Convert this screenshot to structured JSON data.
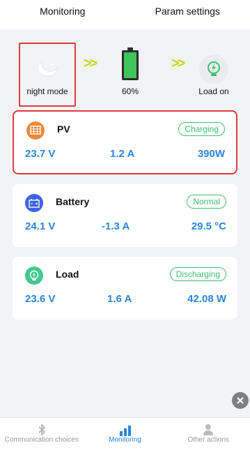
{
  "top_tabs": {
    "monitoring": "Monitoring",
    "param_settings": "Param settings"
  },
  "flow": {
    "mode_label": "night mode",
    "battery_label": "60%",
    "battery_level": 0.6,
    "load_label": "Load on"
  },
  "cards": {
    "pv": {
      "name": "PV",
      "status": "Charging",
      "voltage": "23.7 V",
      "current": "1.2 A",
      "power": "390W"
    },
    "battery": {
      "name": "Battery",
      "status": "Normal",
      "voltage": "24.1 V",
      "current": "-1.3 A",
      "temperature": "29.5 °C"
    },
    "load": {
      "name": "Load",
      "status": "Discharging",
      "voltage": "23.6 V",
      "current": "1.6 A",
      "power": "42.08 W"
    }
  },
  "bottom_nav": {
    "communication": "Communication choices",
    "monitoring": "Monitoring",
    "other": "Other actions"
  },
  "colors": {
    "accent": "#2a86d7",
    "status_green": "#3bbf6e",
    "highlight": "#e23a3a",
    "chevron": "#c8d81e"
  }
}
